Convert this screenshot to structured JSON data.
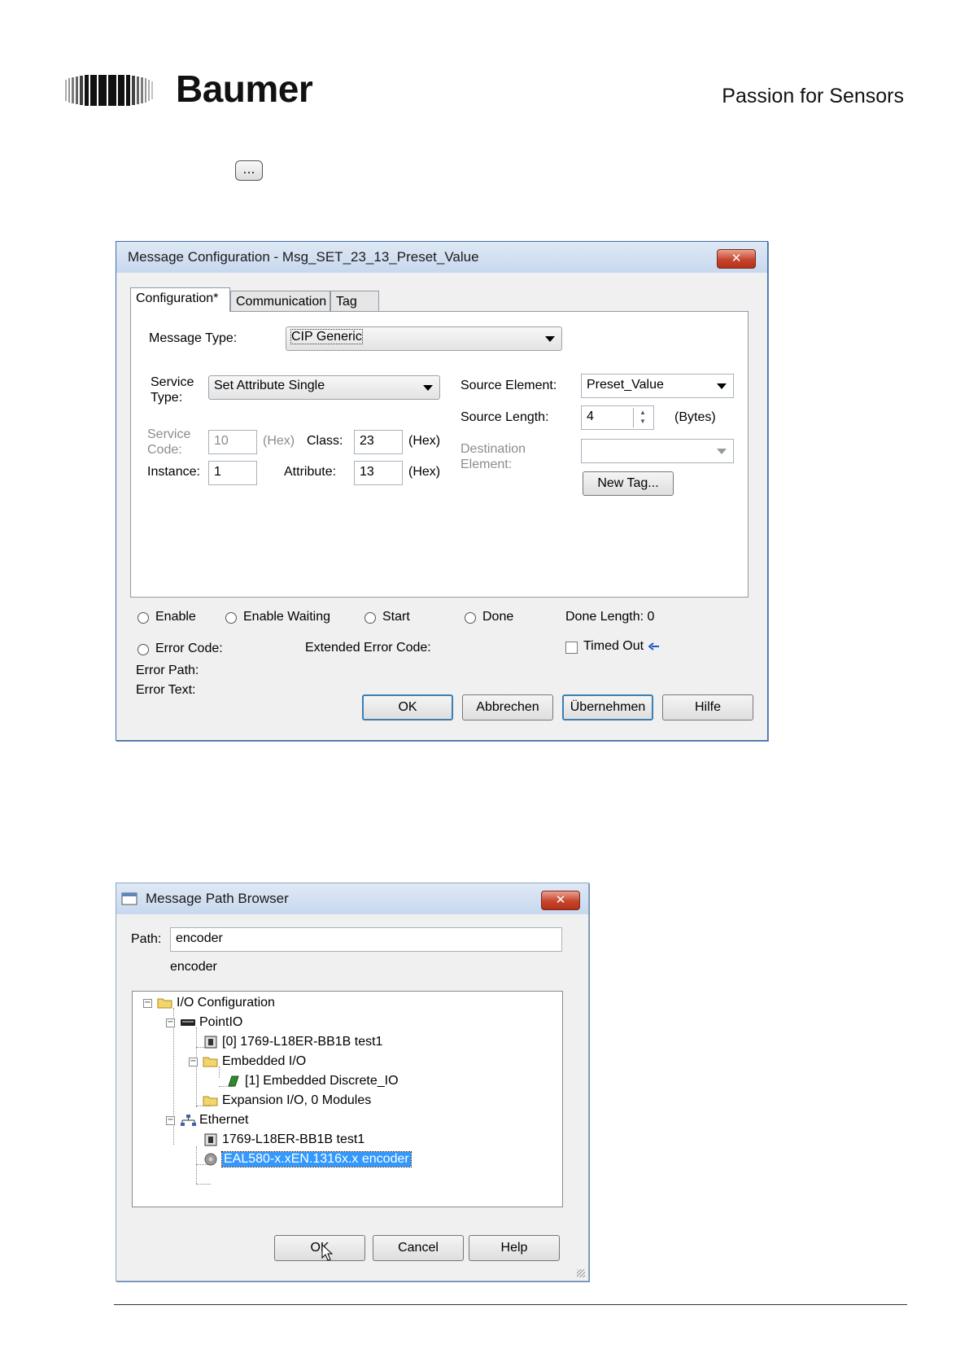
{
  "header": {
    "brand": "Baumer",
    "tagline": "Passion for Sensors",
    "ellipsis_button": "..."
  },
  "msg_config": {
    "title": "Message Configuration - Msg_SET_23_13_Preset_Value",
    "close": "✕",
    "tabs": [
      "Configuration*",
      "Communication",
      "Tag"
    ],
    "message_type_label": "Message Type:",
    "message_type_value": "CIP Generic",
    "service_type_label_1": "Service",
    "service_type_label_2": "Type:",
    "service_type_value": "Set Attribute Single",
    "service_code_label_1": "Service",
    "service_code_label_2": "Code:",
    "service_code_value": "10",
    "hex1": "(Hex)",
    "class_label": "Class:",
    "class_value": "23",
    "hex2": "(Hex)",
    "instance_label": "Instance:",
    "instance_value": "1",
    "attribute_label": "Attribute:",
    "attribute_value": "13",
    "hex3": "(Hex)",
    "source_element_label": "Source Element:",
    "source_element_value": "Preset_Value",
    "source_length_label": "Source Length:",
    "source_length_value": "4",
    "bytes_label": "(Bytes)",
    "destination_label_1": "Destination",
    "destination_label_2": "Element:",
    "destination_value": "",
    "new_tag_button": "New Tag...",
    "status": {
      "enable": "Enable",
      "enable_waiting": "Enable Waiting",
      "start": "Start",
      "done": "Done",
      "done_length": "Done Length:  0",
      "error_code": "Error Code:",
      "extended_error_code": "Extended Error Code:",
      "timed_out": "Timed Out",
      "error_path": "Error Path:",
      "error_text": "Error Text:"
    },
    "buttons": {
      "ok": "OK",
      "cancel": "Abbrechen",
      "apply": "Übernehmen",
      "help": "Hilfe"
    }
  },
  "path_browser": {
    "title": "Message Path Browser",
    "close": "✕",
    "path_label": "Path:",
    "path_value": "encoder",
    "path_display": "encoder",
    "tree": {
      "io_configuration": "I/O Configuration",
      "pointio": "PointIO",
      "controller_0": "[0] 1769-L18ER-BB1B test1",
      "embedded_io": "Embedded I/O",
      "embedded_discrete": "[1] Embedded Discrete_IO",
      "expansion_io": "Expansion I/O, 0 Modules",
      "ethernet": "Ethernet",
      "controller_eth": "1769-L18ER-BB1B test1",
      "encoder": "EAL580-x.xEN.1316x.x encoder"
    },
    "buttons": {
      "ok": "OK",
      "cancel": "Cancel",
      "help": "Help"
    }
  },
  "colors": {
    "title_bar": "#c7d8ee",
    "close_button": "#c6442c",
    "selection": "#3399ff",
    "default_button_border": "#3c7fb1"
  }
}
